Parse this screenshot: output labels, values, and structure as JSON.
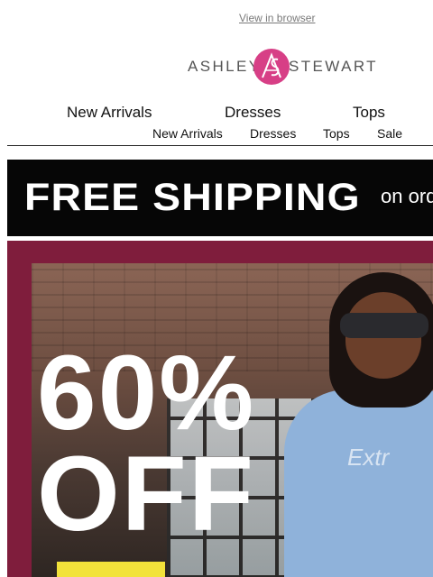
{
  "header": {
    "view_in_browser": "View in browser",
    "logo": {
      "left": "ASHLEY",
      "right": "STEWART",
      "monogram": "AS",
      "color": "#d73f86"
    }
  },
  "nav_primary": [
    "New Arrivals",
    "Dresses",
    "Tops"
  ],
  "nav_secondary": [
    "New Arrivals",
    "Dresses",
    "Tops",
    "Sale"
  ],
  "banner": {
    "headline": "FREE SHIPPING",
    "trailing": "on ord",
    "background": "#060606"
  },
  "hero": {
    "line1": "60%",
    "line2": "OFF",
    "shirt_print": "Extr",
    "background": "#7f1d3c"
  }
}
